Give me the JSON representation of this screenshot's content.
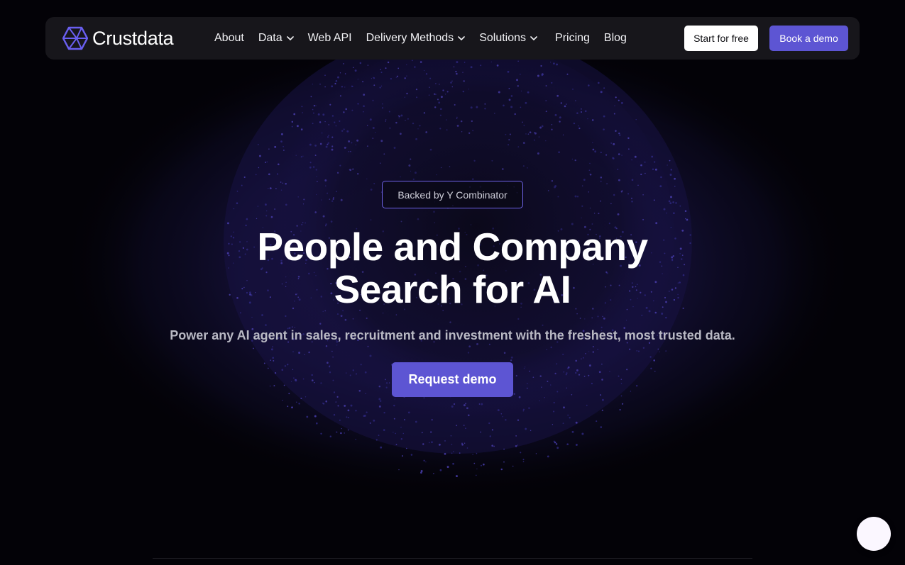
{
  "brand": {
    "name": "Crustdata",
    "accent": "#5d55d3"
  },
  "nav": {
    "items": [
      {
        "label": "About",
        "dropdown": false
      },
      {
        "label": "Data",
        "dropdown": true
      },
      {
        "label": "Web API",
        "dropdown": false
      },
      {
        "label": "Delivery Methods",
        "dropdown": true
      },
      {
        "label": "Solutions",
        "dropdown": true
      },
      {
        "label": "Pricing",
        "dropdown": false
      },
      {
        "label": "Blog",
        "dropdown": false
      }
    ],
    "start_label": "Start for free",
    "book_label": "Book a demo"
  },
  "hero": {
    "badge": "Backed by Y Combinator",
    "headline_line1": "People and Company",
    "headline_line2": "Search for AI",
    "subtitle": "Power any AI agent in sales, recruitment and investment with the freshest, most trusted data.",
    "cta_label": "Request demo"
  },
  "icons": {
    "logo": "crustdata-hexagon-logo-icon",
    "chevron": "chevron-down-icon",
    "chat": "chat-bubble-icon"
  }
}
